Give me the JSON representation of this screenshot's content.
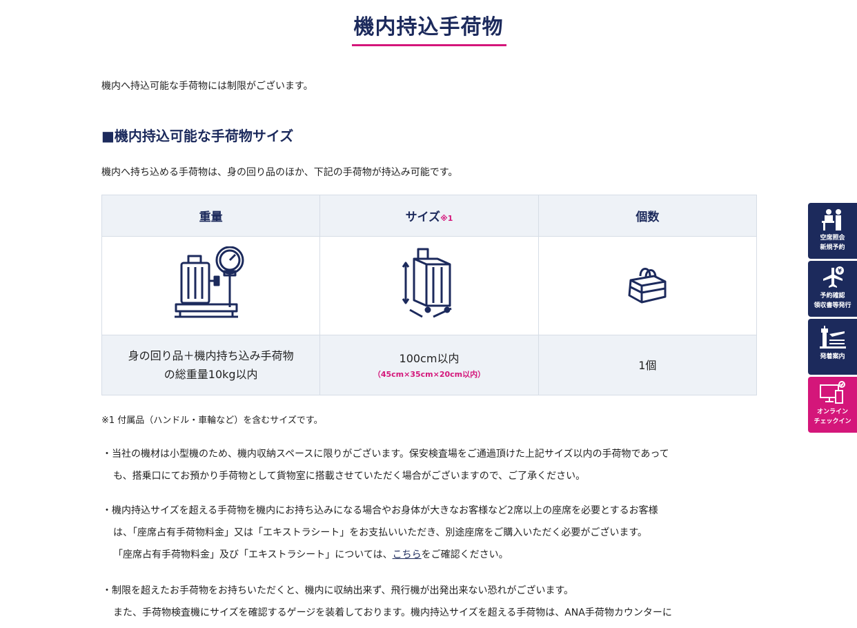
{
  "page": {
    "title": "機内持込手荷物",
    "intro": "機内へ持込可能な手荷物には制限がございます。"
  },
  "section": {
    "heading": "■機内持込可能な手荷物サイズ",
    "desc": "機内へ持ち込める手荷物は、身の回り品のほか、下記の手荷物が持込み可能です。"
  },
  "table": {
    "headers": {
      "weight": "重量",
      "size": "サイズ",
      "size_mark": "※1",
      "count": "個数"
    },
    "icons": {
      "weight": "suitcase-scale-icon",
      "size": "suitcase-dimension-icon",
      "count": "bag-icon"
    },
    "values": {
      "weight_line1": "身の回り品＋機内持ち込み手荷物",
      "weight_line2": "の総重量10kg以内",
      "size": "100cm以内",
      "size_detail": "（45cm×35cm×20cm以内）",
      "count": "1個"
    }
  },
  "footnote": "※1 付属品（ハンドル・車輪など）を含むサイズです。",
  "bullets": {
    "b1_l1": "・当社の機材は小型機のため、機内収納スペースに限りがございます。保安検査場をご通過頂けた上記サイズ以内の手荷物であって",
    "b1_l2": "も、搭乗口にてお預かり手荷物として貨物室に搭載させていただく場合がございますので、ご了承ください。",
    "b2_l1": "・機内持込サイズを超える手荷物を機内にお持ち込みになる場合やお身体が大きなお客様など2席以上の座席を必要とするお客様",
    "b2_l2": "は、「座席占有手荷物料金」又は「エキストラシート」をお支払いいただき、別途座席をご購入いただく必要がございます。",
    "b2_l3_pre": "「座席占有手荷物料金」及び「エキストラシート」については、",
    "b2_link": "こちら",
    "b2_l3_post": "をご確認ください。",
    "b3_l1": "・制限を超えたお手荷物をお持ちいただくと、機内に収納出来ず、飛行機が出発出来ない恐れがございます。",
    "b3_l2": "また、手荷物検査機にサイズを確認するゲージを装着しております。機内持込サイズを超える手荷物は、ANA手荷物カウンターに"
  },
  "side_nav": [
    {
      "line1": "空席照会",
      "line2": "新規予約",
      "icon": "counter-staff-icon"
    },
    {
      "line1": "予約確認",
      "line2": "領収書等発行",
      "icon": "plane-yen-icon"
    },
    {
      "line1": "発着案内",
      "line2": "",
      "icon": "control-tower-icon"
    },
    {
      "line1": "オンライン",
      "line2": "チェックイン",
      "icon": "online-checkin-icon",
      "color": "#d4167a"
    }
  ],
  "colors": {
    "navy": "#1c2a5c",
    "accent": "#d4167a",
    "table_bg": "#eef2f7"
  }
}
